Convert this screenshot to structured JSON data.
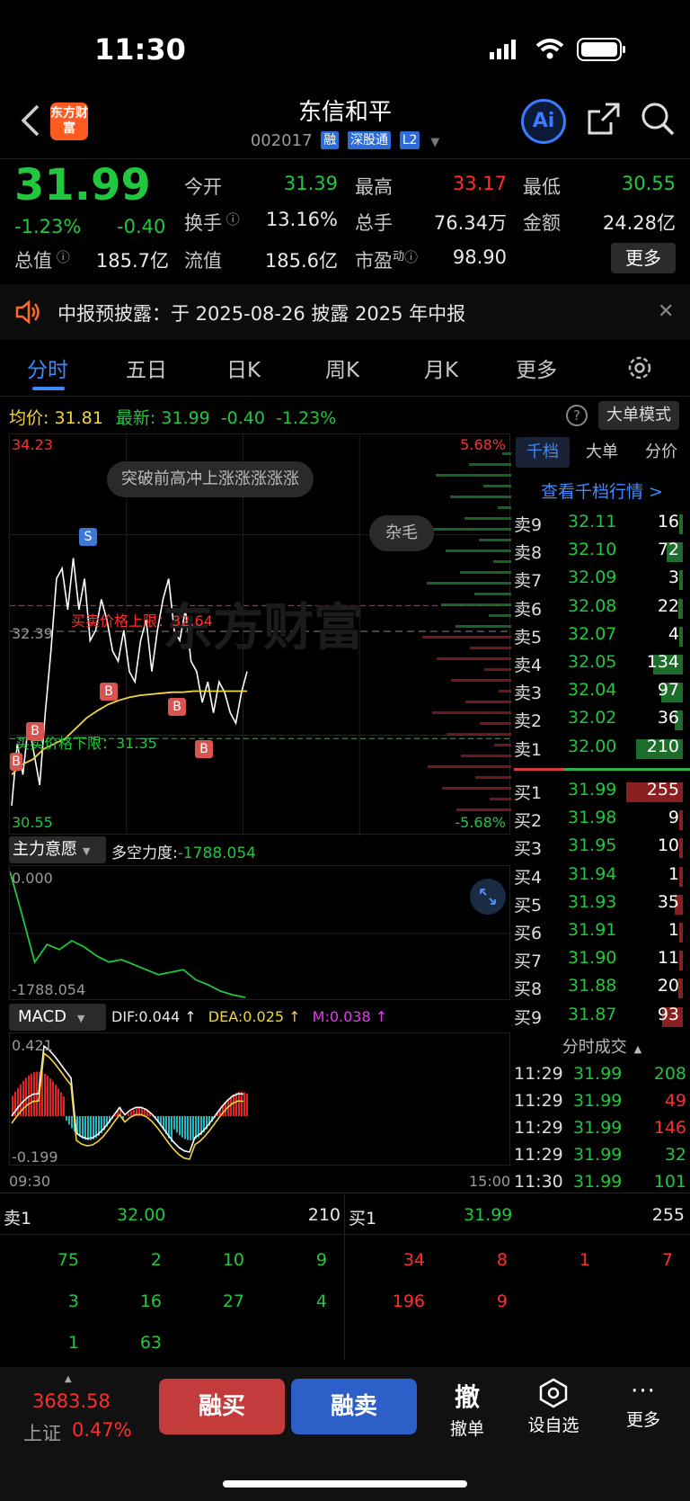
{
  "status": {
    "time": "11:30"
  },
  "header": {
    "title": "东信和平",
    "code": "002017",
    "tags": [
      "融",
      "深股通",
      "L2"
    ],
    "logo_text": "东方财富",
    "ai_label": "Ai"
  },
  "quote": {
    "price": "31.99",
    "change_pct": "-1.23%",
    "change": "-0.40",
    "rows": [
      [
        {
          "label": "今开",
          "value": "31.39",
          "color": "green"
        },
        {
          "label": "最高",
          "value": "33.17",
          "color": "red"
        },
        {
          "label": "最低",
          "value": "30.55",
          "color": "green"
        }
      ],
      [
        {
          "label": "换手",
          "value": "13.16%",
          "color": "white"
        },
        {
          "label": "总手",
          "value": "76.34万",
          "color": "white"
        },
        {
          "label": "金额",
          "value": "24.28亿",
          "color": "white"
        }
      ],
      [
        {
          "label": "总值",
          "value": "185.7亿",
          "color": "white"
        },
        {
          "label": "流值",
          "value": "185.6亿",
          "color": "white"
        },
        {
          "label": "市盈",
          "value": "98.90",
          "color": "white"
        }
      ]
    ],
    "pe_sup": "动",
    "more_label": "更多"
  },
  "notice": {
    "text": "中报预披露：于 2025-08-26 披露 2025 年中报"
  },
  "tabs": [
    "分时",
    "五日",
    "日K",
    "周K",
    "月K",
    "更多"
  ],
  "avg_bar": {
    "avg_label": "均价:",
    "avg_value": "31.81",
    "latest_label": "最新:",
    "latest_value": "31.99",
    "change": "-0.40",
    "change_pct": "-1.23%",
    "big_order_label": "大单模式"
  },
  "chart": {
    "y_high": "34.23",
    "y_low": "30.55",
    "y_prev": "32.39",
    "pct_high": "5.68%",
    "pct_low": "-5.68%",
    "bubble1": "突破前高冲上涨涨涨涨涨",
    "bubble2": "杂毛",
    "upper_label": "买卖价格上限：32.64",
    "lower_label": "买卖价格下限：31.35",
    "markers": [
      "S",
      "B",
      "B",
      "B",
      "B",
      "B"
    ],
    "watermark": "东方财富"
  },
  "chart_data": {
    "type": "line",
    "title": "",
    "y_range": [
      30.55,
      34.23
    ],
    "prev_close": 32.39,
    "series": [
      {
        "name": "最新",
        "values": [
          30.7,
          31.3,
          31.0,
          31.5,
          31.2,
          30.9,
          31.6,
          32.2,
          32.9,
          33.0,
          32.6,
          33.1,
          32.6,
          32.9,
          32.3,
          32.4,
          32.7,
          32.5,
          32.2,
          32.1,
          32.4,
          32.0,
          31.9,
          32.3,
          32.5,
          32.0,
          32.4,
          32.7,
          32.9,
          32.4,
          32.3,
          32.6,
          32.1,
          32.0,
          31.7,
          31.9,
          31.6,
          31.9,
          31.8,
          31.6,
          31.5,
          31.8,
          32.0
        ]
      },
      {
        "name": "均价",
        "values": [
          31.0,
          31.1,
          31.15,
          31.25,
          31.3,
          31.35,
          31.45,
          31.55,
          31.62,
          31.68,
          31.72,
          31.75,
          31.77,
          31.78,
          31.79,
          31.8,
          31.8,
          31.81,
          31.81,
          31.81,
          31.81,
          31.81,
          31.81
        ]
      }
    ]
  },
  "indicator": {
    "name": "主力意愿",
    "label": "多空力度:",
    "value": "-1788.054",
    "top": "0.000",
    "bottom": "-1788.054"
  },
  "macd": {
    "name": "MACD",
    "dif": "DIF:0.044 ↑",
    "dea": "DEA:0.025 ↑",
    "m": "M:0.038 ↑",
    "top": "0.421",
    "bottom": "-0.199",
    "time_start": "09:30",
    "time_end": "15:00"
  },
  "orderbook": {
    "tabs": [
      "千档",
      "大单",
      "分价"
    ],
    "link": "查看千档行情 >",
    "asks": [
      {
        "label": "卖9",
        "price": "32.11",
        "vol": "16"
      },
      {
        "label": "卖8",
        "price": "32.10",
        "vol": "72"
      },
      {
        "label": "卖7",
        "price": "32.09",
        "vol": "3"
      },
      {
        "label": "卖6",
        "price": "32.08",
        "vol": "22"
      },
      {
        "label": "卖5",
        "price": "32.07",
        "vol": "4"
      },
      {
        "label": "卖4",
        "price": "32.05",
        "vol": "134"
      },
      {
        "label": "卖3",
        "price": "32.04",
        "vol": "97"
      },
      {
        "label": "卖2",
        "price": "32.02",
        "vol": "36"
      },
      {
        "label": "卖1",
        "price": "32.00",
        "vol": "210"
      }
    ],
    "bids": [
      {
        "label": "买1",
        "price": "31.99",
        "vol": "255"
      },
      {
        "label": "买2",
        "price": "31.98",
        "vol": "9"
      },
      {
        "label": "买3",
        "price": "31.95",
        "vol": "10"
      },
      {
        "label": "买4",
        "price": "31.94",
        "vol": "1"
      },
      {
        "label": "买5",
        "price": "31.93",
        "vol": "35"
      },
      {
        "label": "买6",
        "price": "31.91",
        "vol": "1"
      },
      {
        "label": "买7",
        "price": "31.90",
        "vol": "11"
      },
      {
        "label": "买8",
        "price": "31.88",
        "vol": "20"
      },
      {
        "label": "买9",
        "price": "31.87",
        "vol": "93"
      }
    ],
    "trades_title": "分时成交",
    "trades": [
      {
        "time": "11:29",
        "price": "31.99",
        "vol": "208",
        "color": "green"
      },
      {
        "time": "11:29",
        "price": "31.99",
        "vol": "49",
        "color": "red"
      },
      {
        "time": "11:29",
        "price": "31.99",
        "vol": "146",
        "color": "red"
      },
      {
        "time": "11:29",
        "price": "31.99",
        "vol": "32",
        "color": "green"
      },
      {
        "time": "11:30",
        "price": "31.99",
        "vol": "101",
        "color": "green"
      }
    ]
  },
  "queue": {
    "sell_label": "卖1",
    "sell_price": "32.00",
    "sell_vol": "210",
    "buy_label": "买1",
    "buy_price": "31.99",
    "buy_vol": "255",
    "sell_rows": [
      [
        "75",
        "2",
        "10",
        "9"
      ],
      [
        "3",
        "16",
        "27",
        "4"
      ],
      [
        "1",
        "63",
        "",
        ""
      ]
    ],
    "buy_rows": [
      [
        "34",
        "8",
        "1",
        "7"
      ],
      [
        "196",
        "9",
        "",
        ""
      ]
    ]
  },
  "bottom": {
    "index_value": "3683.58",
    "index_name": "上证",
    "index_pct": "0.47%",
    "buy_label": "融买",
    "sell_label": "融卖",
    "cancel_icon": "撤",
    "cancel_label": "撤单",
    "watch_label": "设自选",
    "more_label": "更多"
  }
}
